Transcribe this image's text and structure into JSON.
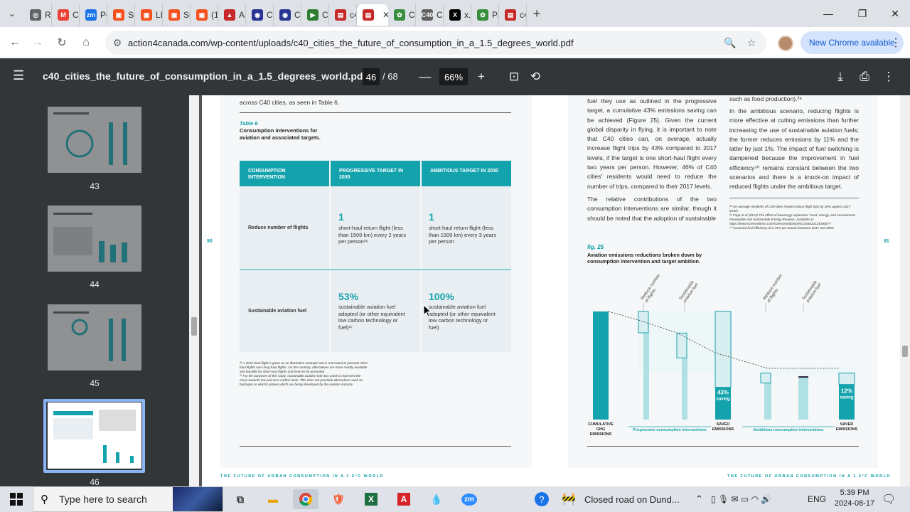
{
  "tabs": [
    {
      "label": "Ro",
      "color": "#5f6368",
      "glyph": "◎"
    },
    {
      "label": "Co",
      "color": "#ea4335",
      "glyph": "M"
    },
    {
      "label": "Po",
      "color": "#1a73e8",
      "glyph": "zm"
    },
    {
      "label": "Su",
      "color": "#f4511e",
      "glyph": "▣"
    },
    {
      "label": "LIS",
      "color": "#f4511e",
      "glyph": "▣"
    },
    {
      "label": "Su",
      "color": "#f4511e",
      "glyph": "▣"
    },
    {
      "label": "(1)",
      "color": "#f4511e",
      "glyph": "▣"
    },
    {
      "label": "A \\",
      "color": "#c62828",
      "glyph": "▲"
    },
    {
      "label": "Co",
      "color": "#283593",
      "glyph": "◉"
    },
    {
      "label": "Co",
      "color": "#283593",
      "glyph": "◉"
    },
    {
      "label": "Cl",
      "color": "#2e7d32",
      "glyph": "▶"
    },
    {
      "label": "c4",
      "color": "#c62828",
      "glyph": "▤"
    },
    {
      "label": "",
      "color": "#c62828",
      "glyph": "▤"
    },
    {
      "label": "Ca",
      "color": "#388e3c",
      "glyph": "✿"
    },
    {
      "label": "Cit",
      "color": "#616161",
      "glyph": "C40"
    },
    {
      "label": "x.c",
      "color": "#000000",
      "glyph": "X"
    },
    {
      "label": "Pa",
      "color": "#388e3c",
      "glyph": "✿"
    },
    {
      "label": "c4",
      "color": "#c62828",
      "glyph": "▤"
    }
  ],
  "browser": {
    "url": "action4canada.com/wp-content/uploads/c40_cities_the_future_of_consumption_in_a_1.5_degrees_world.pdf",
    "new_chrome_label": "New Chrome available"
  },
  "pdf": {
    "title": "c40_cities_the_future_of_consumption_in_a_1.5_degrees_world.pdf",
    "current_page": "46",
    "total_pages": "/ 68",
    "zoom": "66%"
  },
  "thumbnails": [
    {
      "num": "43"
    },
    {
      "num": "44"
    },
    {
      "num": "45"
    },
    {
      "num": "46"
    }
  ],
  "page_left": {
    "intro_text": "across C40 cities, as seen in Table 6.",
    "table_label": "Table 6",
    "table_caption_1": "Consumption interventions for",
    "table_caption_2": "aviation and associated targets.",
    "headers": {
      "intervention": "CONSUMPTION INTERVENTION",
      "progressive": "PROGRESSIVE TARGET IN 2030",
      "ambitious": "AMBITIOUS TARGET IN 2030"
    },
    "rows": [
      {
        "name": "Reduce number of flights",
        "prog_num": "1",
        "prog_text": "short-haul return flight (less than 1500 km) every 2 years per person³⁶",
        "amb_num": "1",
        "amb_text": "short-haul return flight (less than 1500 km) every 3 years per person"
      },
      {
        "name": "Sustainable aviation fuel",
        "prog_num": "53%",
        "prog_text": "sustainable aviation fuel adopted (or other equivalent low carbon technology or fuel)³⁷",
        "amb_num": "100%",
        "amb_text": "sustainable aviation fuel adopted (or other equivalent low carbon technology or fuel)"
      }
    ],
    "footnotes": "³⁶ A short-haul flight is given as an illustrative example and is not meant to promote short-haul flights over long-haul flights. On the contrary, alternatives are more readily available and feasible for short-haul flights and need to be promoted\n³⁷ For the purposes of this study, sustainable aviation fuel was used to represent the move towards low and zero carbon fuels. This does not preclude alternatives such as hydrogen or electric planes which are being developed by the aviation industry",
    "page_number": "90",
    "footer": "THE FUTURE OF URBAN CONSUMPTION IN A 1.5°C WORLD"
  },
  "page_right": {
    "col1": "fuel they use as outlined in the progressive target, a cumulative 43% emissions saving can be achieved (Figure 25). Given the current global disparity in flying, it is important to note that C40 cities can, on average, actually increase flight trips by 43% compared to 2017 levels, if the target is one short-haul flight every two years per person. However, 46% of C40 cities' residents would need to reduce the number of trips, compared to their 2017 levels.",
    "col1b": "The relative contributions of the two consumption interventions are similar, though it should be noted that the adoption of sustainable",
    "col2_top": "such as food production).³⁹",
    "col2": "In the ambitious scenario, reducing flights is more effective at cutting emissions than further increasing the use of sustainable aviation fuels; the former reduces emissions by 11% and the latter by just 1%. The impact of fuel switching is dampened because the improvement in fuel efficiency⁴⁰ remains constant between the two scenarios and there is a knock-on impact of reduced flights under the ambitious target.",
    "footnotes": "³⁸ On average residents of C40 cities should reduce flight trips by 26% against 2017 levels.\n³⁹ Fripp et al (2014) The effect of bioenergy expansion: Food, energy, and environment. Renewable and Sustainable Energy Reviews. Available at: https://www.sciencedirect.com/science/article/pii/S1364032114000677\n⁴⁰ Assumed fuel efficiency of 2.75% per annum between 2017 and 2050",
    "fig_label": "fig. 25",
    "fig_caption_1": "Aviation emissions reductions broken down by",
    "fig_caption_2": "consumption intervention and target ambition.",
    "page_number": "91",
    "footer": "THE FUTURE OF URBAN CONSUMPTION IN A 1.5°C WORLD"
  },
  "chart_data": {
    "type": "bar",
    "categories": [
      "CUMULATIVE GHG EMISSIONS",
      "Reduce number of flights",
      "Sustainable aviation fuel",
      "SAVED EMISSIONS",
      "Reduce number of flights",
      "Sustainable aviation fuel",
      "SAVED EMISSIONS"
    ],
    "values": [
      100,
      100,
      80,
      43,
      43,
      44,
      12
    ],
    "annotations": [
      "43% saving",
      "12% saving"
    ],
    "group_labels": [
      "Progressive consumption interventions",
      "Ambitious consumption interventions"
    ],
    "colors": {
      "solid": "#14a3ad",
      "light": "#aee0e4"
    }
  },
  "taskbar": {
    "search_placeholder": "Type here to search",
    "news": "Closed road on Dund...",
    "lang": "ENG",
    "time": "5:39 PM",
    "date": "2024-08-17"
  }
}
